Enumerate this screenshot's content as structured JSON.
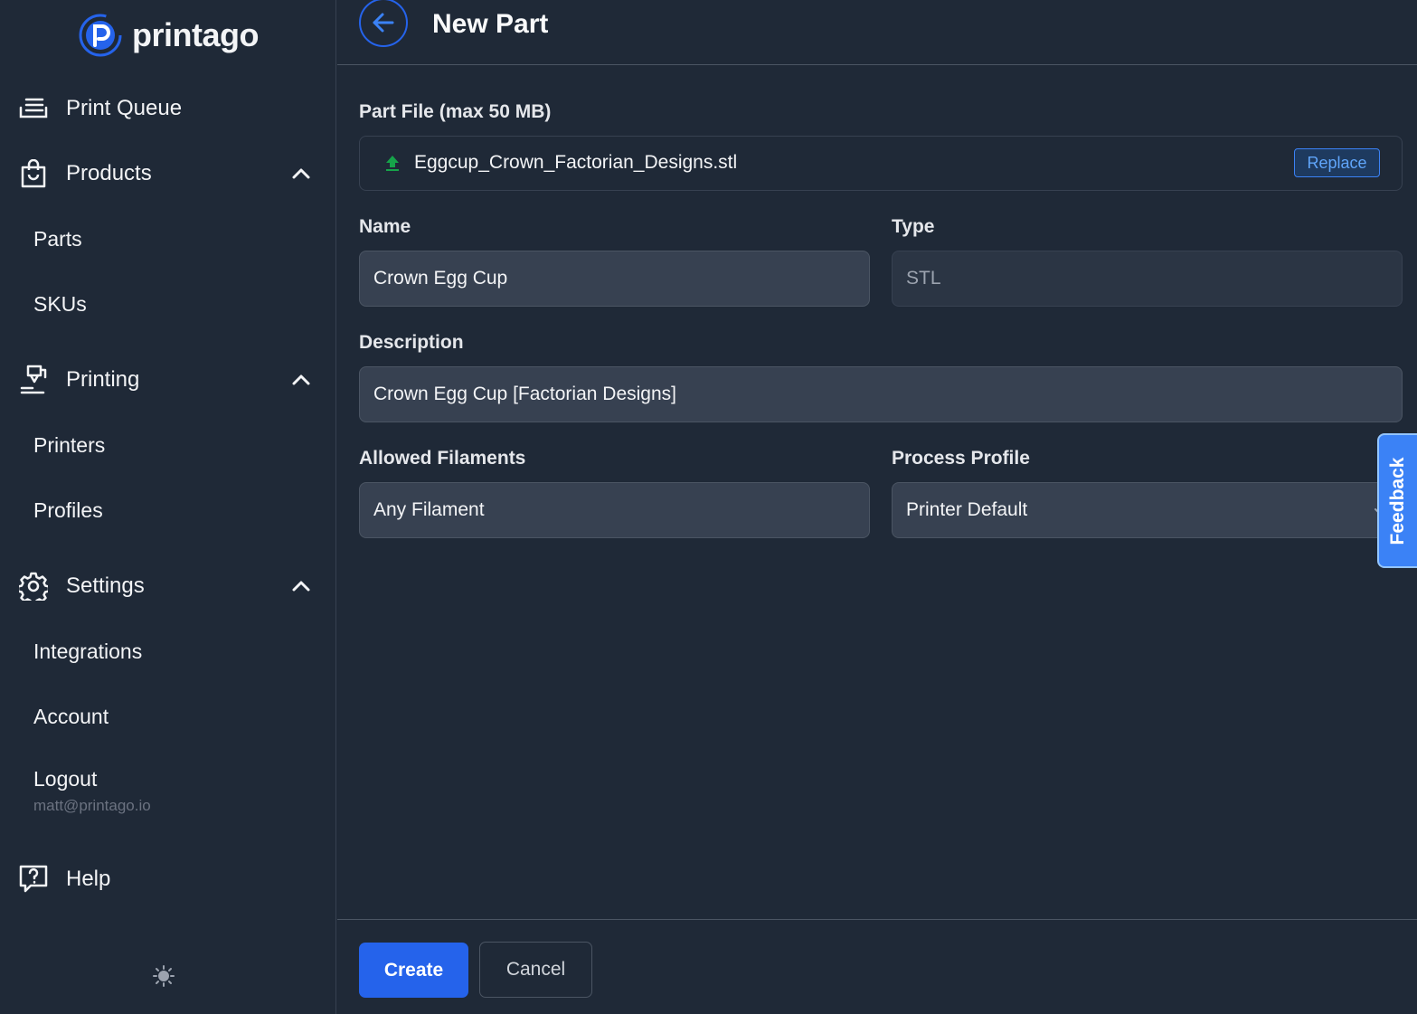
{
  "brand": {
    "name": "printago"
  },
  "sidebar": {
    "print_queue": "Print Queue",
    "products": {
      "label": "Products",
      "items": [
        "Parts",
        "SKUs"
      ]
    },
    "printing": {
      "label": "Printing",
      "items": [
        "Printers",
        "Profiles"
      ]
    },
    "settings": {
      "label": "Settings",
      "items": [
        "Integrations",
        "Account"
      ]
    },
    "logout": {
      "label": "Logout",
      "email": "matt@printago.io"
    },
    "help": "Help"
  },
  "header": {
    "title": "New Part"
  },
  "form": {
    "part_file": {
      "label": "Part File (max 50 MB)",
      "file_name": "Eggcup_Crown_Factorian_Designs.stl",
      "replace_label": "Replace"
    },
    "name": {
      "label": "Name",
      "value": "Crown Egg Cup"
    },
    "type": {
      "label": "Type",
      "value": "STL"
    },
    "description": {
      "label": "Description",
      "value": "Crown Egg Cup [Factorian Designs]"
    },
    "allowed_filaments": {
      "label": "Allowed Filaments",
      "value": "Any Filament"
    },
    "process_profile": {
      "label": "Process Profile",
      "value": "Printer Default"
    }
  },
  "footer": {
    "create_label": "Create",
    "cancel_label": "Cancel"
  },
  "feedback": {
    "label": "Feedback"
  },
  "colors": {
    "accent": "#2563eb",
    "background": "#1f2937",
    "input": "#374151",
    "upload_icon": "#16a34a"
  }
}
